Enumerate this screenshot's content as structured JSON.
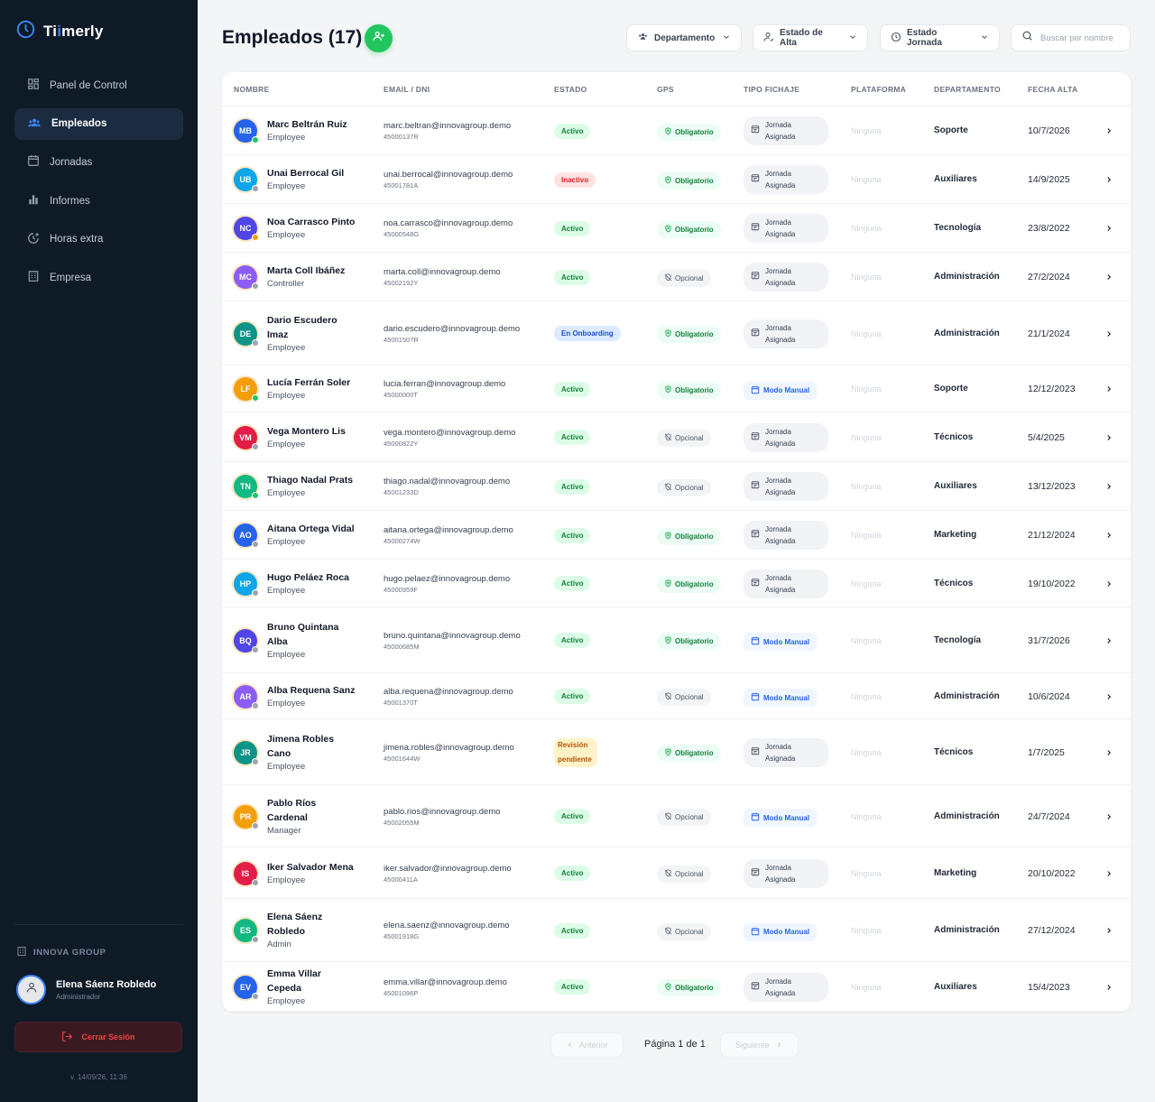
{
  "app": {
    "logo_prefix": "Ti",
    "logo_accent": "i",
    "logo_suffix": "merly",
    "accent": "#3b82f6",
    "sidebar_bg": "#0f1a27"
  },
  "sidebar": {
    "items": [
      {
        "label": "Panel de Control",
        "icon": "dashboard-icon",
        "active": false
      },
      {
        "label": "Empleados",
        "icon": "users-icon",
        "active": true
      },
      {
        "label": "Jornadas",
        "icon": "calendar-icon",
        "active": false
      },
      {
        "label": "Informes",
        "icon": "bar-chart-icon",
        "active": false
      },
      {
        "label": "Horas extra",
        "icon": "clock-plus-icon",
        "active": false
      },
      {
        "label": "Empresa",
        "icon": "building-icon",
        "active": false
      }
    ],
    "org_name": "INNOVA GROUP",
    "user_name": "Elena Sáenz Robledo",
    "user_role": "Administrador",
    "logout_label": "Cerrar Sesión",
    "version": "v. 14/09/26, 11:36"
  },
  "header": {
    "title": "Empleados (17)",
    "filters": {
      "departamento": "Departamento",
      "estado_alta": "Estado de Alta",
      "estado_jornada": "Estado Jornada"
    },
    "search_placeholder": "Buscar por nombre"
  },
  "table": {
    "columns": {
      "nombre": "NOMBRE",
      "email": "EMAIL / DNI",
      "estado": "ESTADO",
      "gps": "GPS",
      "tipo": "TIPO FICHAJE",
      "plataforma": "PLATAFORMA",
      "departamento": "DEPARTAMENTO",
      "fecha": "FECHA ALTA"
    },
    "rows": [
      {
        "initials": "MB",
        "avatar_color": "#2563eb",
        "dot": "#22c55e",
        "name1": "Marc Beltrán Ruiz",
        "name2": "",
        "role": "Employee",
        "email": "marc.beltran@innovagroup.demo",
        "dni": "45000137R",
        "estado": "Activo",
        "estado_kind": "activo",
        "gps": "Obligatorio",
        "tipo1": "Jornada",
        "tipo2": "Asignada",
        "tipo_kind": "jornada",
        "plataforma": "Ninguna",
        "departamento": "Soporte",
        "fecha": "10/7/2026"
      },
      {
        "initials": "UB",
        "avatar_color": "#0ea5e9",
        "dot": "#9ca3af",
        "name1": "Unai Berrocal Gil",
        "name2": "",
        "role": "Employee",
        "email": "unai.berrocal@innovagroup.demo",
        "dni": "45001781A",
        "estado": "Inactivo",
        "estado_kind": "inactivo",
        "gps": "Obligatorio",
        "tipo1": "Jornada",
        "tipo2": "Asignada",
        "tipo_kind": "jornada",
        "plataforma": "Ninguna",
        "departamento": "Auxiliares",
        "fecha": "14/9/2025"
      },
      {
        "initials": "NC",
        "avatar_color": "#4f46e5",
        "dot": "#f59e0b",
        "name1": "Noa Carrasco Pinto",
        "name2": "",
        "role": "Employee",
        "email": "noa.carrasco@innovagroup.demo",
        "dni": "45000548G",
        "estado": "Activo",
        "estado_kind": "activo",
        "gps": "Obligatorio",
        "tipo1": "Jornada",
        "tipo2": "Asignada",
        "tipo_kind": "jornada",
        "plataforma": "Ninguna",
        "departamento": "Tecnología",
        "fecha": "23/8/2022"
      },
      {
        "initials": "MC",
        "avatar_color": "#8b5cf6",
        "dot": "#9ca3af",
        "name1": "Marta Coll Ibáñez",
        "name2": "",
        "role": "Controller",
        "email": "marta.coll@innovagroup.demo",
        "dni": "45002192Y",
        "estado": "Activo",
        "estado_kind": "activo",
        "gps": "Opcional",
        "tipo1": "Jornada",
        "tipo2": "Asignada",
        "tipo_kind": "jornada",
        "plataforma": "Ninguna",
        "departamento": "Administración",
        "fecha": "27/2/2024"
      },
      {
        "initials": "DE",
        "avatar_color": "#0d9488",
        "dot": "#9ca3af",
        "name1": "Dario Escudero",
        "name2": "Imaz",
        "role": "Employee",
        "email": "dario.escudero@innovagroup.demo",
        "dni": "45001507R",
        "estado": "En Onboarding",
        "estado_kind": "onboarding",
        "gps": "Obligatorio",
        "tipo1": "Jornada",
        "tipo2": "Asignada",
        "tipo_kind": "jornada",
        "plataforma": "Ninguna",
        "departamento": "Administración",
        "fecha": "21/1/2024"
      },
      {
        "initials": "LF",
        "avatar_color": "#f59e0b",
        "dot": "#22c55e",
        "name1": "Lucía Ferrán Soler",
        "name2": "",
        "role": "Employee",
        "email": "lucia.ferran@innovagroup.demo",
        "dni": "45000000T",
        "estado": "Activo",
        "estado_kind": "activo",
        "gps": "Obligatorio",
        "tipo1": "Modo Manual",
        "tipo2": "",
        "tipo_kind": "manual",
        "plataforma": "Ninguna",
        "departamento": "Soporte",
        "fecha": "12/12/2023"
      },
      {
        "initials": "VM",
        "avatar_color": "#e11d48",
        "dot": "#9ca3af",
        "name1": "Vega Montero Lis",
        "name2": "",
        "role": "Employee",
        "email": "vega.montero@innovagroup.demo",
        "dni": "45000822Y",
        "estado": "Activo",
        "estado_kind": "activo",
        "gps": "Opcional",
        "tipo1": "Jornada",
        "tipo2": "Asignada",
        "tipo_kind": "jornada",
        "plataforma": "Ninguna",
        "departamento": "Técnicos",
        "fecha": "5/4/2025"
      },
      {
        "initials": "TN",
        "avatar_color": "#10b981",
        "dot": "#22c55e",
        "name1": "Thiago Nadal Prats",
        "name2": "",
        "role": "Employee",
        "email": "thiago.nadal@innovagroup.demo",
        "dni": "45001233D",
        "estado": "Activo",
        "estado_kind": "activo",
        "gps": "Opcional",
        "tipo1": "Jornada",
        "tipo2": "Asignada",
        "tipo_kind": "jornada",
        "plataforma": "Ninguna",
        "departamento": "Auxiliares",
        "fecha": "13/12/2023"
      },
      {
        "initials": "AO",
        "avatar_color": "#2563eb",
        "dot": "#9ca3af",
        "name1": "Aitana Ortega Vidal",
        "name2": "",
        "role": "Employee",
        "email": "aitana.ortega@innovagroup.demo",
        "dni": "45000274W",
        "estado": "Activo",
        "estado_kind": "activo",
        "gps": "Obligatorio",
        "tipo1": "Jornada",
        "tipo2": "Asignada",
        "tipo_kind": "jornada",
        "plataforma": "Ninguna",
        "departamento": "Marketing",
        "fecha": "21/12/2024"
      },
      {
        "initials": "HP",
        "avatar_color": "#0ea5e9",
        "dot": "#9ca3af",
        "name1": "Hugo Peláez Roca",
        "name2": "",
        "role": "Employee",
        "email": "hugo.pelaez@innovagroup.demo",
        "dni": "45000959F",
        "estado": "Activo",
        "estado_kind": "activo",
        "gps": "Obligatorio",
        "tipo1": "Jornada",
        "tipo2": "Asignada",
        "tipo_kind": "jornada",
        "plataforma": "Ninguna",
        "departamento": "Técnicos",
        "fecha": "19/10/2022"
      },
      {
        "initials": "BQ",
        "avatar_color": "#4f46e5",
        "dot": "#9ca3af",
        "name1": "Bruno Quintana",
        "name2": "Alba",
        "role": "Employee",
        "email": "bruno.quintana@innovagroup.demo",
        "dni": "45000685M",
        "estado": "Activo",
        "estado_kind": "activo",
        "gps": "Obligatorio",
        "tipo1": "Modo Manual",
        "tipo2": "",
        "tipo_kind": "manual",
        "plataforma": "Ninguna",
        "departamento": "Tecnología",
        "fecha": "31/7/2026"
      },
      {
        "initials": "AR",
        "avatar_color": "#8b5cf6",
        "dot": "#9ca3af",
        "name1": "Alba Requena Sanz",
        "name2": "",
        "role": "Employee",
        "email": "alba.requena@innovagroup.demo",
        "dni": "45001370T",
        "estado": "Activo",
        "estado_kind": "activo",
        "gps": "Opcional",
        "tipo1": "Modo Manual",
        "tipo2": "",
        "tipo_kind": "manual",
        "plataforma": "Ninguna",
        "departamento": "Administración",
        "fecha": "10/6/2024"
      },
      {
        "initials": "JR",
        "avatar_color": "#0d9488",
        "dot": "#9ca3af",
        "name1": "Jimena Robles",
        "name2": "Cano",
        "role": "Employee",
        "email": "jimena.robles@innovagroup.demo",
        "dni": "45001644W",
        "estado": "Revisión pendiente",
        "estado_kind": "revision",
        "gps": "Obligatorio",
        "tipo1": "Jornada",
        "tipo2": "Asignada",
        "tipo_kind": "jornada",
        "plataforma": "Ninguna",
        "departamento": "Técnicos",
        "fecha": "1/7/2025"
      },
      {
        "initials": "PR",
        "avatar_color": "#f59e0b",
        "dot": "#9ca3af",
        "name1": "Pablo Ríos",
        "name2": "Cardenal",
        "role": "Manager",
        "email": "pablo.rios@innovagroup.demo",
        "dni": "45002055M",
        "estado": "Activo",
        "estado_kind": "activo",
        "gps": "Opcional",
        "tipo1": "Modo Manual",
        "tipo2": "",
        "tipo_kind": "manual",
        "plataforma": "Ninguna",
        "departamento": "Administración",
        "fecha": "24/7/2024"
      },
      {
        "initials": "IS",
        "avatar_color": "#e11d48",
        "dot": "#9ca3af",
        "name1": "Iker Salvador Mena",
        "name2": "",
        "role": "Employee",
        "email": "iker.salvador@innovagroup.demo",
        "dni": "45000411A",
        "estado": "Activo",
        "estado_kind": "activo",
        "gps": "Opcional",
        "tipo1": "Jornada",
        "tipo2": "Asignada",
        "tipo_kind": "jornada",
        "plataforma": "Ninguna",
        "departamento": "Marketing",
        "fecha": "20/10/2022"
      },
      {
        "initials": "ES",
        "avatar_color": "#10b981",
        "dot": "#9ca3af",
        "name1": "Elena Sáenz",
        "name2": "Robledo",
        "role": "Admin",
        "email": "elena.saenz@innovagroup.demo",
        "dni": "45001918G",
        "estado": "Activo",
        "estado_kind": "activo",
        "gps": "Opcional",
        "tipo1": "Modo Manual",
        "tipo2": "",
        "tipo_kind": "manual",
        "plataforma": "Ninguna",
        "departamento": "Administración",
        "fecha": "27/12/2024"
      },
      {
        "initials": "EV",
        "avatar_color": "#2563eb",
        "dot": "#9ca3af",
        "name1": "Emma Villar",
        "name2": "Cepeda",
        "role": "Employee",
        "email": "emma.villar@innovagroup.demo",
        "dni": "45001096P",
        "estado": "Activo",
        "estado_kind": "activo",
        "gps": "Obligatorio",
        "tipo1": "Jornada",
        "tipo2": "Asignada",
        "tipo_kind": "jornada",
        "plataforma": "Ninguna",
        "departamento": "Auxiliares",
        "fecha": "15/4/2023"
      }
    ]
  },
  "pagination": {
    "prev": "Anterior",
    "info": "Página 1 de 1",
    "next": "Siguiente"
  }
}
